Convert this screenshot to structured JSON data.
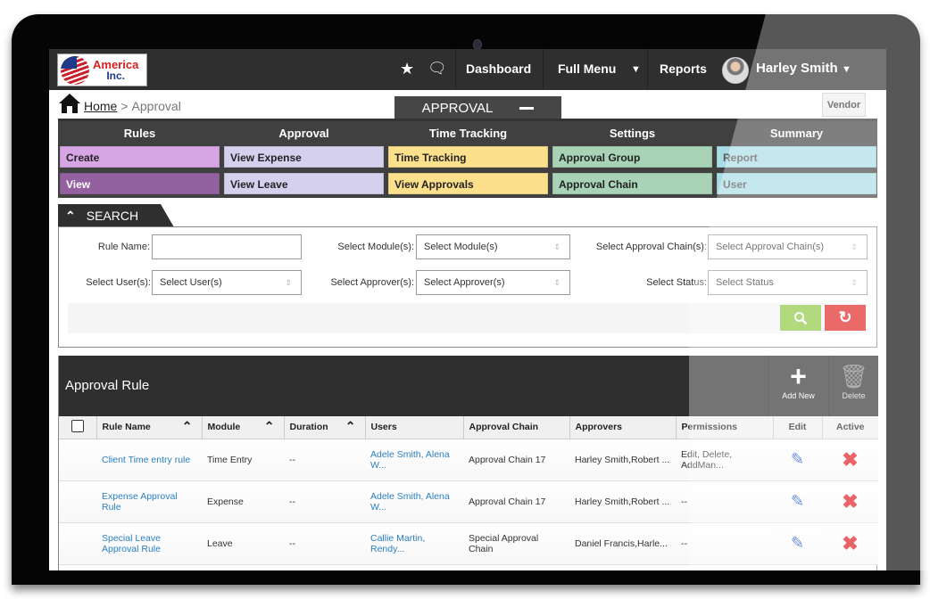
{
  "header": {
    "logo": {
      "line1": "America",
      "line2": "Inc."
    },
    "icons": {
      "favorites": "star-icon",
      "messages": "chat-icon"
    },
    "nav": {
      "dashboard": "Dashboard",
      "full_menu": "Full Menu",
      "full_menu_caret": "▼",
      "reports": "Reports"
    },
    "user": {
      "name": "Harley Smith",
      "caret": "▼"
    }
  },
  "breadcrumb": {
    "home": "Home",
    "separator": ">",
    "current": "Approval"
  },
  "section_tab": {
    "label": "APPROVAL"
  },
  "vendor_button": "Vendor",
  "menu": {
    "columns": [
      {
        "title": "Rules",
        "items": [
          {
            "label": "Create",
            "color": "#d5a6e3"
          },
          {
            "label": "View",
            "color": "#9361a0"
          }
        ]
      },
      {
        "title": "Approval",
        "items": [
          {
            "label": "View Expense",
            "color": "#d4d0ee"
          },
          {
            "label": "View Leave",
            "color": "#d4d0ee"
          }
        ]
      },
      {
        "title": "Time Tracking",
        "items": [
          {
            "label": "Time Tracking",
            "color": "#fde08c"
          },
          {
            "label": "View Approvals",
            "color": "#fde08c"
          }
        ]
      },
      {
        "title": "Settings",
        "items": [
          {
            "label": "Approval Group",
            "color": "#a8d3b6"
          },
          {
            "label": "Approval Chain",
            "color": "#a8d3b6"
          }
        ]
      },
      {
        "title": "Summary",
        "items": [
          {
            "label": "Report",
            "color": "#a9dde6"
          },
          {
            "label": "User",
            "color": "#a9dde6"
          }
        ]
      }
    ]
  },
  "search": {
    "title": "SEARCH",
    "rule_name_label": "Rule Name:",
    "rule_name_value": "",
    "module_label": "Select Module(s):",
    "module_value": "Select Module(s)",
    "chain_label": "Select Approval Chain(s):",
    "chain_value": "Select Approval Chain(s)",
    "user_label": "Select User(s):",
    "user_value": "Select User(s)",
    "approver_label": "Select Approver(s):",
    "approver_value": "Select Approver(s)",
    "status_label": "Select Status:",
    "status_value": "Select Status",
    "select_arrows": "⇕"
  },
  "rules": {
    "title": "Approval Rule",
    "add_new": "Add New",
    "delete": "Delete",
    "columns": [
      "",
      "Rule Name",
      "Module",
      "Duration",
      "Users",
      "Approval Chain",
      "Approvers",
      "Permissions",
      "Edit",
      "Active"
    ],
    "rows": [
      {
        "rule_name": "Client Time entry rule",
        "module": "Time Entry",
        "duration": "--",
        "users": "Adele Smith, Alena W...",
        "chain": "Approval Chain 17",
        "approvers": "Harley Smith,Robert ...",
        "permissions": "Edit, Delete, AddMan..."
      },
      {
        "rule_name": "Expense Approval Rule",
        "module": "Expense",
        "duration": "--",
        "users": "Adele Smith, Alena W...",
        "chain": "Approval Chain 17",
        "approvers": "Harley Smith,Robert ...",
        "permissions": "--"
      },
      {
        "rule_name": "Special Leave Approval Rule",
        "module": "Leave",
        "duration": "--",
        "users": "Callie Martin, Rendy...",
        "chain": "Special Approval Chain",
        "approvers": "Daniel Francis,Harle...",
        "permissions": "--"
      }
    ]
  }
}
